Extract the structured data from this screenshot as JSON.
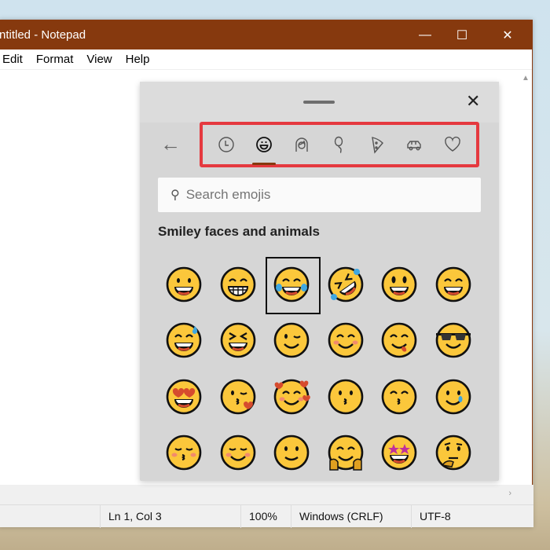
{
  "window": {
    "title": "ntitled - Notepad",
    "minimize": "—",
    "maximize": "☐",
    "close": "✕"
  },
  "menu": [
    "Edit",
    "Format",
    "View",
    "Help"
  ],
  "status": {
    "position": "Ln 1, Col 3",
    "zoom": "100%",
    "line_ending": "Windows (CRLF)",
    "encoding": "UTF-8"
  },
  "emoji_panel": {
    "close": "✕",
    "back": "←",
    "tabs": [
      {
        "name": "recent",
        "icon": "clock-icon"
      },
      {
        "name": "smileys",
        "icon": "smiley-icon",
        "active": true
      },
      {
        "name": "people",
        "icon": "person-icon"
      },
      {
        "name": "celebration",
        "icon": "balloon-icon"
      },
      {
        "name": "food",
        "icon": "pizza-icon"
      },
      {
        "name": "travel",
        "icon": "car-icon"
      },
      {
        "name": "symbols",
        "icon": "heart-icon"
      }
    ],
    "search_placeholder": "Search emojis",
    "category_title": "Smiley faces and animals",
    "selected_index": 2,
    "emojis": [
      "grinning-face",
      "beaming-face",
      "face-with-tears-of-joy",
      "rolling-on-floor-laughing",
      "grinning-face-big-eyes",
      "grinning-face-smiling-eyes",
      "grinning-face-with-sweat",
      "grinning-squinting-face",
      "winking-face",
      "smiling-face-with-smiling-eyes",
      "face-savoring-food",
      "smiling-face-with-sunglasses",
      "smiling-face-with-heart-eyes",
      "face-blowing-a-kiss",
      "smiling-face-with-hearts",
      "kissing-face",
      "kissing-face-with-smiling-eyes",
      "smiling-face-with-tear",
      "kissing-face-with-closed-eyes",
      "smiling-face",
      "slightly-smiling-face",
      "hugging-face",
      "star-struck",
      "thinking-face"
    ]
  }
}
